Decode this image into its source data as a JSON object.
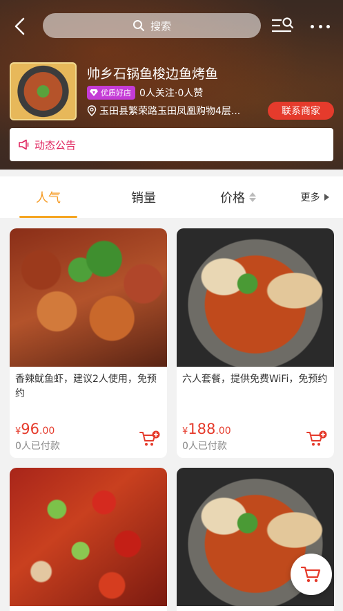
{
  "topbar": {
    "search_placeholder": "搜索",
    "icons": {
      "back": "back-icon",
      "search": "search-icon",
      "list_search": "list-search-icon",
      "more": "more-icon"
    }
  },
  "shop": {
    "name": "帅乡石锅鱼梭边鱼烤鱼",
    "badge": "优质好店",
    "stats": "0人关注·0人赞",
    "address": "玉田县繁荣路玉田凤凰购物4层...",
    "contact_label": "联系商家"
  },
  "notice": {
    "label": "动态公告"
  },
  "sort_tabs": {
    "popular": "人气",
    "sales": "销量",
    "price": "价格",
    "more": "更多"
  },
  "products": [
    {
      "title": "香辣鱿鱼虾，建议2人使用，免预约",
      "currency": "¥",
      "price_int": "96",
      "price_dec": ".00",
      "paid": "0人已付款"
    },
    {
      "title": "六人套餐，提供免费WiFi，免预约",
      "currency": "¥",
      "price_int": "188",
      "price_dec": ".00",
      "paid": "0人已付款"
    }
  ],
  "colors": {
    "accent": "#f59a23",
    "price": "#e53b2c",
    "notice": "#e0245e",
    "badge": "#c43bd6"
  }
}
